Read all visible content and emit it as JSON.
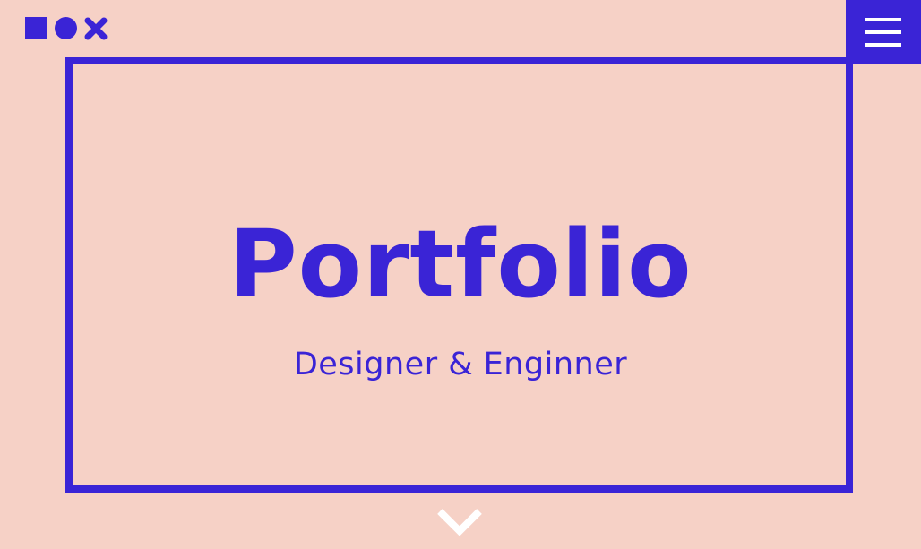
{
  "colors": {
    "background": "#f6d1c6",
    "accent": "#3a24d6",
    "chevron": "#ffffff"
  },
  "header": {
    "logo_icons": [
      "square-icon",
      "circle-icon",
      "x-icon"
    ],
    "menu_icon": "hamburger-menu-icon"
  },
  "hero": {
    "title": "Portfolio",
    "subtitle": "Designer & Enginner"
  },
  "footer": {
    "scroll_icon": "chevron-down-icon"
  }
}
